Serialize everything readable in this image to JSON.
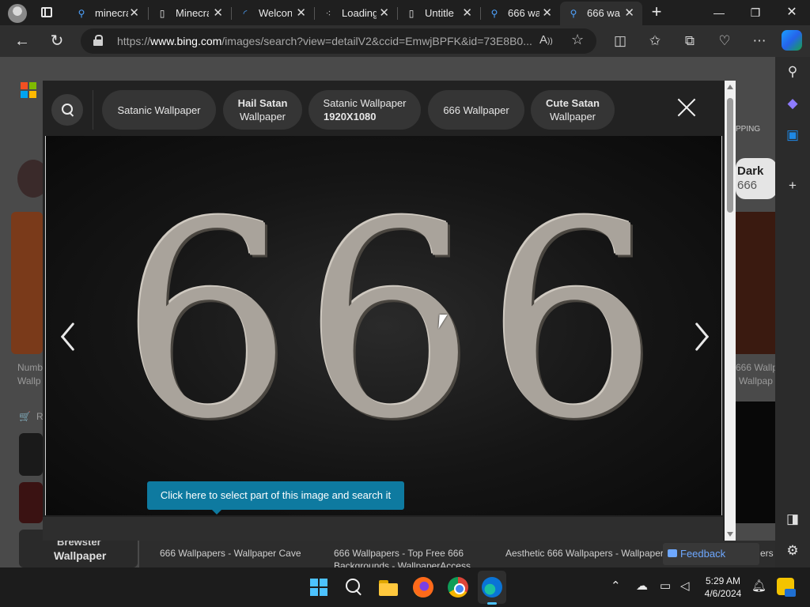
{
  "tabs": [
    {
      "title": "minecra",
      "icon": "search-icon"
    },
    {
      "title": "Minecra",
      "icon": "page-icon"
    },
    {
      "title": "Welcon",
      "icon": "loading-icon"
    },
    {
      "title": "Loading",
      "icon": "loading-icon"
    },
    {
      "title": "Untitle",
      "icon": "page-icon"
    },
    {
      "title": "666 wa",
      "icon": "search-icon"
    },
    {
      "title": "666 wa",
      "icon": "search-icon",
      "active": true
    }
  ],
  "address": {
    "prefix": "https://",
    "domain": "www.bing.com",
    "path": "/images/search?view=detailV2&ccid=EmwjBPFK&id=73E8B0..."
  },
  "chips": [
    {
      "line1": "Satanic Wallpaper",
      "line2": "",
      "bold1": false,
      "bold2": false
    },
    {
      "line1": "Hail Satan",
      "line2": "Wallpaper",
      "bold1": true,
      "bold2": false
    },
    {
      "line1": "Satanic Wallpaper",
      "line2": "1920X1080",
      "bold1": false,
      "bold2": true
    },
    {
      "line1": "666 Wallpaper",
      "line2": "",
      "bold1": false,
      "bold2": false
    },
    {
      "line1": "Cute Satan",
      "line2": "Wallpaper",
      "bold1": true,
      "bold2": false
    }
  ],
  "image": {
    "digits": "666"
  },
  "visual_search_tip": "Click here to select part of this image and search it",
  "background": {
    "left_label_1": "Numb",
    "left_label_2": "Wallp",
    "right_label_1": "666 Wallp",
    "right_label_2": "Wallpap",
    "dark_1": "Dark",
    "dark_2": "666",
    "shopping": "PPING",
    "brewster_1": "Brewster",
    "brewster_2": "Wallpaper",
    "cart_label": "R"
  },
  "results": [
    "666 Wallpapers - Wallpaper Cave",
    "666 Wallpapers - Top Free 666",
    "Aesthetic 666 Wallpapers - Wallpaper",
    "ers"
  ],
  "results_sub": "Backgrounds - WallpaperAccess",
  "feedback_label": "Feedback",
  "clock": {
    "time": "5:29 AM",
    "date": "4/6/2024"
  },
  "colors": {
    "accent": "#0e7aa0",
    "tab_active": "#2f2f2f",
    "taskbar": "#1c1c1c"
  }
}
